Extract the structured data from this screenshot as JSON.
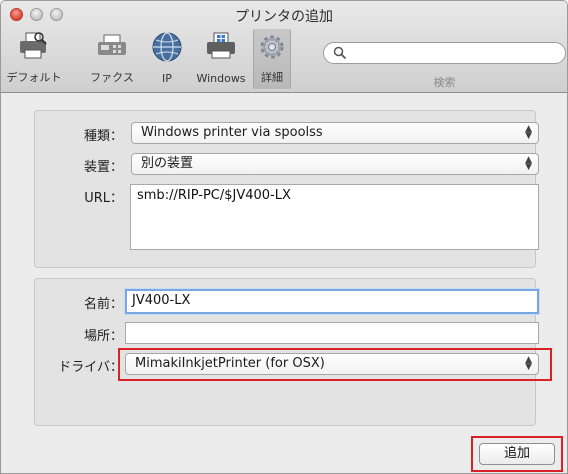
{
  "window": {
    "title": "プリンタの追加"
  },
  "toolbar": {
    "buttons": [
      {
        "label": "デフォルト",
        "icon": "default-printer-icon"
      },
      {
        "label": "ファクス",
        "icon": "fax-icon"
      },
      {
        "label": "IP",
        "icon": "globe-icon"
      },
      {
        "label": "Windows",
        "icon": "windows-printer-icon"
      },
      {
        "label": "詳細",
        "icon": "gear-icon",
        "selected": true
      }
    ],
    "search": {
      "placeholder": "",
      "label": "検索"
    }
  },
  "connection": {
    "type_label": "種類：",
    "type_value": "Windows printer via spoolss",
    "device_label": "装置：",
    "device_value": "別の装置",
    "url_label": "URL：",
    "url_value": "smb://RIP-PC/$JV400-LX"
  },
  "details": {
    "name_label": "名前：",
    "name_value": "JV400-LX",
    "location_label": "場所：",
    "location_value": "",
    "driver_label": "ドライバ：",
    "driver_value": "MimakiInkjetPrinter (for OSX)"
  },
  "actions": {
    "add_label": "追加"
  },
  "colors": {
    "highlight": "#d92127",
    "focus": "#7aa7e2"
  }
}
